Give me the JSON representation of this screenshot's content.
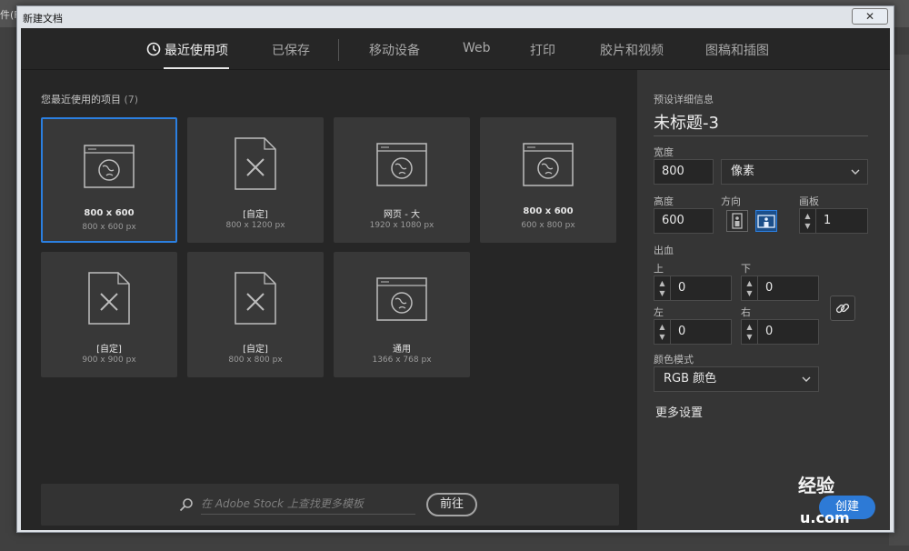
{
  "background": {
    "menu_text": "件(F"
  },
  "window": {
    "title": "新建文档",
    "close": "✕"
  },
  "tabs": [
    {
      "label": "最近使用项",
      "active": true
    },
    {
      "label": "已保存"
    },
    {
      "label": "移动设备"
    },
    {
      "label": "Web"
    },
    {
      "label": "打印"
    },
    {
      "label": "胶片和视频"
    },
    {
      "label": "图稿和插图"
    }
  ],
  "recent": {
    "label": "您最近使用的项目",
    "count": "(7)",
    "items": [
      {
        "name": "800 x 600",
        "size": "800 x 600 px",
        "type": "web",
        "selected": true
      },
      {
        "name": "[自定]",
        "size": "800 x 1200 px",
        "type": "doc"
      },
      {
        "name": "网页 - 大",
        "size": "1920 x 1080 px",
        "type": "web"
      },
      {
        "name": "800 x 600",
        "size": "600 x 800 px",
        "type": "web"
      },
      {
        "name": "[自定]",
        "size": "900 x 900 px",
        "type": "doc"
      },
      {
        "name": "[自定]",
        "size": "800 x 800 px",
        "type": "doc"
      },
      {
        "name": "通用",
        "size": "1366 x 768 px",
        "type": "web"
      }
    ]
  },
  "search": {
    "placeholder": "在 Adobe Stock 上查找更多模板",
    "go_label": "前往"
  },
  "panel": {
    "header": "预设详细信息",
    "doc_name": "未标题-3",
    "width_label": "宽度",
    "width_value": "800",
    "unit": "像素",
    "height_label": "高度",
    "height_value": "600",
    "orientation_label": "方向",
    "artboard_label": "画板",
    "artboard_value": "1",
    "bleed_label": "出血",
    "top_label": "上",
    "top_value": "0",
    "bottom_label": "下",
    "bottom_value": "0",
    "left_label": "左",
    "left_value": "0",
    "right_label": "右",
    "right_value": "0",
    "color_mode_label": "颜色模式",
    "color_mode_value": "RGB 颜色",
    "more_settings": "更多设置",
    "create_label": "创建"
  },
  "watermark": {
    "line1": "经验",
    "line2": "u.com"
  },
  "colors": {
    "accent": "#2b7fe0",
    "background": "#262626",
    "panel": "#353535"
  }
}
